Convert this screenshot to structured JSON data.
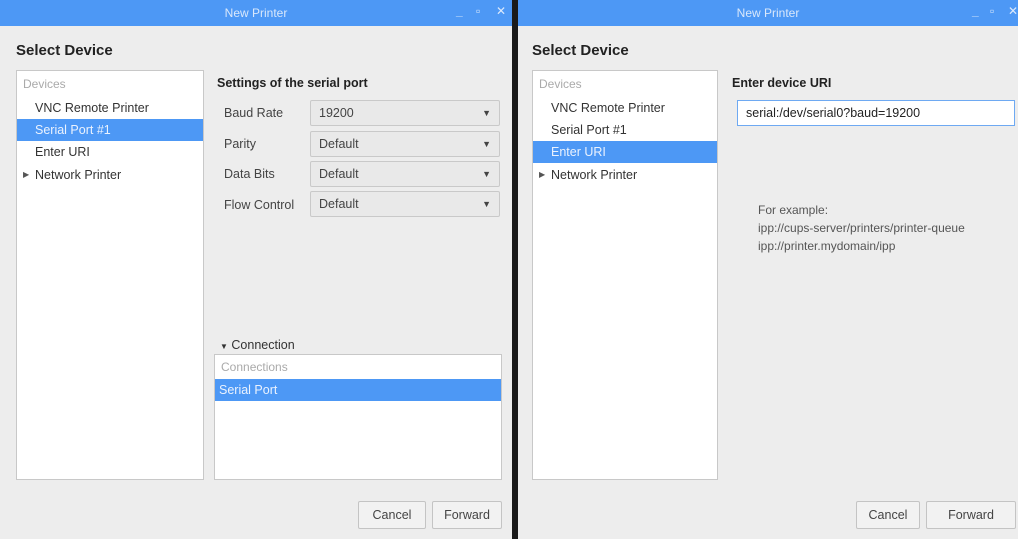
{
  "left_window": {
    "title": "New Printer",
    "controls": {
      "minimize": "_",
      "maximize": "▫",
      "close": "✕"
    },
    "heading": "Select Device",
    "devices": {
      "header": "Devices",
      "items": [
        {
          "label": "VNC Remote Printer",
          "selected": false
        },
        {
          "label": "Serial Port #1",
          "selected": true
        },
        {
          "label": "Enter URI",
          "selected": false
        },
        {
          "label": "Network Printer",
          "selected": false,
          "expandable": true
        }
      ]
    },
    "settings": {
      "title": "Settings of the serial port",
      "rows": [
        {
          "label": "Baud Rate",
          "value": "19200"
        },
        {
          "label": "Parity",
          "value": "Default"
        },
        {
          "label": "Data Bits",
          "value": "Default"
        },
        {
          "label": "Flow Control",
          "value": "Default"
        }
      ]
    },
    "connection": {
      "toggle_label": "Connection",
      "header": "Connections",
      "items": [
        {
          "label": "Serial Port",
          "selected": true
        }
      ]
    },
    "buttons": {
      "cancel": "Cancel",
      "forward": "Forward"
    }
  },
  "right_window": {
    "title": "New Printer",
    "controls": {
      "minimize": "_",
      "maximize": "▫",
      "close": "✕"
    },
    "heading": "Select Device",
    "devices": {
      "header": "Devices",
      "items": [
        {
          "label": "VNC Remote Printer",
          "selected": false
        },
        {
          "label": "Serial Port #1",
          "selected": false
        },
        {
          "label": "Enter URI",
          "selected": true
        },
        {
          "label": "Network Printer",
          "selected": false,
          "expandable": true
        }
      ]
    },
    "uri": {
      "title": "Enter device URI",
      "value": "serial:/dev/serial0?baud=19200"
    },
    "example": {
      "line1": "For example:",
      "line2": "ipp://cups-server/printers/printer-queue",
      "line3": "ipp://printer.mydomain/ipp"
    },
    "buttons": {
      "cancel": "Cancel",
      "forward": "Forward"
    }
  },
  "colors": {
    "accent": "#4d98f5",
    "window_bg": "#ededed"
  },
  "icons": {
    "dropdown": "chevron-down-icon",
    "expander": "triangle-right-icon",
    "collapse": "triangle-down-icon"
  }
}
